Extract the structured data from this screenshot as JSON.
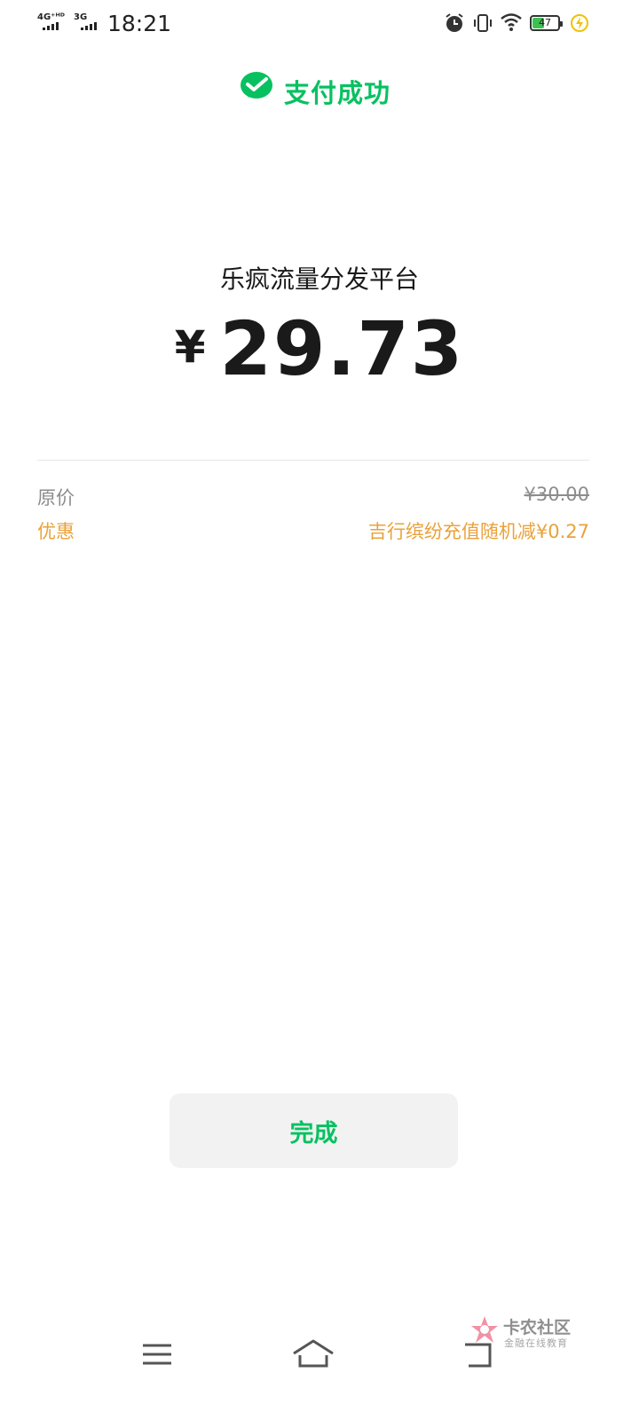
{
  "status_bar": {
    "network_1": "4G⁺ᴴᴰ",
    "network_2": "3G",
    "time": "18:21",
    "battery_level": "47",
    "battery_fraction": 0.47,
    "icons": [
      "alarm-icon",
      "vibrate-icon",
      "wifi-icon",
      "battery-icon",
      "charging-icon"
    ]
  },
  "header": {
    "logo_icon": "wechat-pay-icon",
    "title": "支付成功"
  },
  "payment": {
    "merchant": "乐疯流量分发平台",
    "currency": "¥",
    "amount": "29.73"
  },
  "details": {
    "original_label": "原价",
    "original_value": "¥30.00",
    "discount_label": "优惠",
    "discount_value": "吉行缤纷充值随机减¥0.27"
  },
  "actions": {
    "done_label": "完成"
  },
  "watermark": {
    "title": "卡农社区",
    "subtitle": "金融在线教育"
  },
  "nav_bar": {
    "icons": [
      "menu-icon",
      "home-icon",
      "back-icon"
    ]
  },
  "colors": {
    "accent": "#07c160",
    "discount": "#e9a23b",
    "muted": "#8c8c8c",
    "button_bg": "#f2f2f2"
  }
}
